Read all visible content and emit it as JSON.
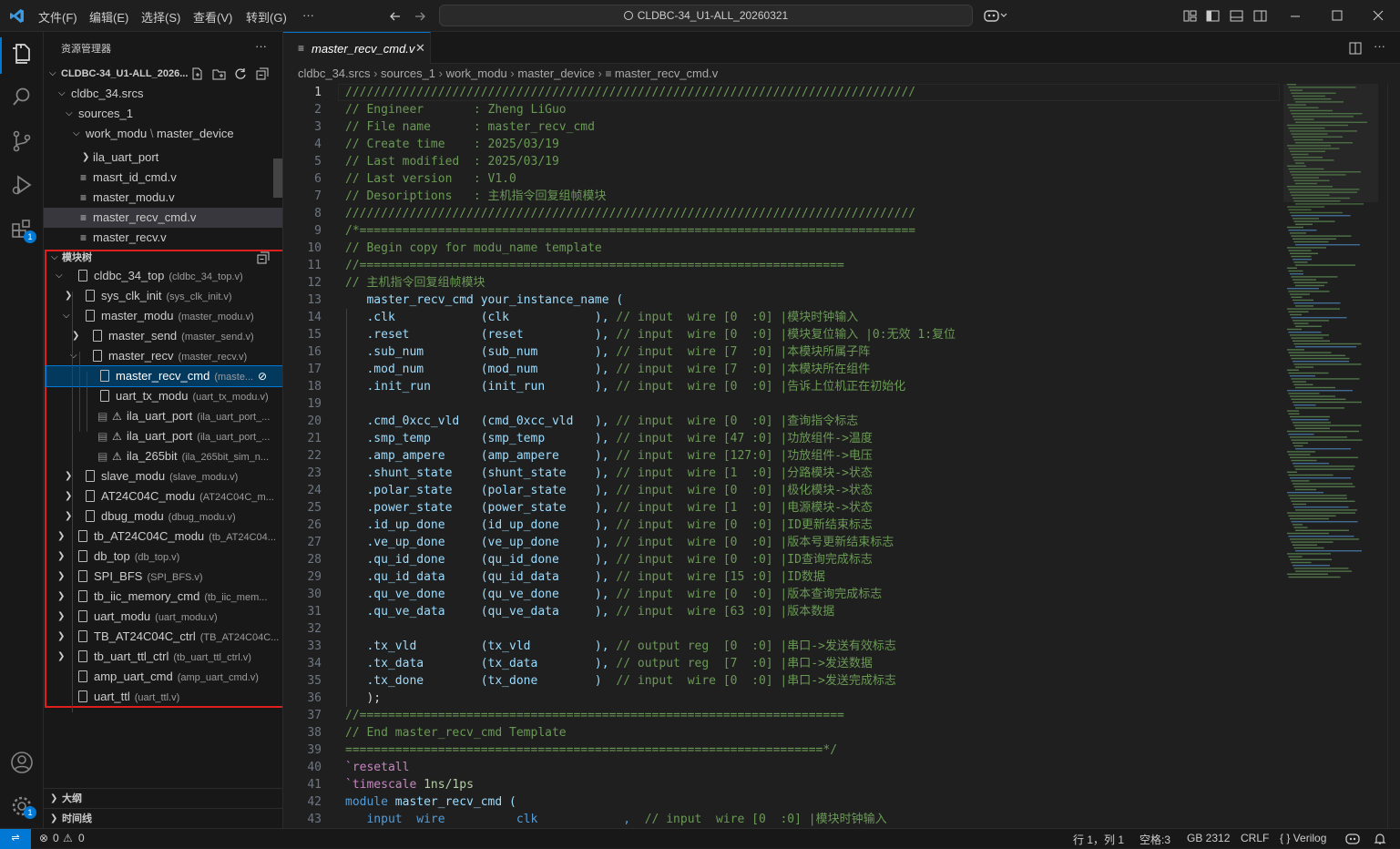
{
  "titlebar": {
    "menus": [
      "文件(F)",
      "编辑(E)",
      "选择(S)",
      "查看(V)",
      "转到(G)",
      "···"
    ],
    "search": "CLDBC-34_U1-ALL_20260321"
  },
  "explorer": {
    "title": "资源管理器",
    "root": "CLDBC-34_U1-ALL_2026...",
    "more": "···",
    "items": [
      {
        "label": "cldbc_34.srcs",
        "kind": "folder"
      },
      {
        "label": "sources_1",
        "kind": "folder"
      },
      {
        "label": "work_modu",
        "kind": "folder",
        "extra": "master_device"
      },
      {
        "label": "ila_uart_port",
        "kind": "folder-closed"
      },
      {
        "label": "masrt_id_cmd.v",
        "kind": "file"
      },
      {
        "label": "master_modu.v",
        "kind": "file"
      },
      {
        "label": "master_recv_cmd.v",
        "kind": "file",
        "selected": true
      },
      {
        "label": "master_recv.v",
        "kind": "file"
      }
    ]
  },
  "module_tree": {
    "title": "模块树",
    "items": [
      {
        "name": "cldbc_34_top",
        "file": "(cldbc_34_top.v)",
        "level": 0,
        "tw": "open"
      },
      {
        "name": "sys_clk_init",
        "file": "(sys_clk_init.v)",
        "level": 1,
        "tw": "closed"
      },
      {
        "name": "master_modu",
        "file": "(master_modu.v)",
        "level": 1,
        "tw": "open"
      },
      {
        "name": "master_send",
        "file": "(master_send.v)",
        "level": 2,
        "tw": "closed"
      },
      {
        "name": "master_recv",
        "file": "(master_recv.v)",
        "level": 2,
        "tw": "open"
      },
      {
        "name": "master_recv_cmd",
        "file": "(maste...",
        "level": 3,
        "tw": "none",
        "selected": true
      },
      {
        "name": "uart_tx_modu",
        "file": "(uart_tx_modu.v)",
        "level": 3,
        "tw": "none"
      },
      {
        "name": "ila_uart_port",
        "file": "(ila_uart_port_...",
        "level": 3,
        "tw": "none",
        "warn": true
      },
      {
        "name": "ila_uart_port",
        "file": "(ila_uart_port_...",
        "level": 3,
        "tw": "none",
        "warn": true
      },
      {
        "name": "ila_265bit",
        "file": "(ila_265bit_sim_n...",
        "level": 3,
        "tw": "none",
        "warn": true
      },
      {
        "name": "slave_modu",
        "file": "(slave_modu.v)",
        "level": 1,
        "tw": "closed"
      },
      {
        "name": "AT24C04C_modu",
        "file": "(AT24C04C_m...",
        "level": 1,
        "tw": "closed"
      },
      {
        "name": "dbug_modu",
        "file": "(dbug_modu.v)",
        "level": 1,
        "tw": "closed"
      },
      {
        "name": "tb_AT24C04C_modu",
        "file": "(tb_AT24C04...",
        "level": 0,
        "tw": "closed"
      },
      {
        "name": "db_top",
        "file": "(db_top.v)",
        "level": 0,
        "tw": "closed"
      },
      {
        "name": "SPI_BFS",
        "file": "(SPI_BFS.v)",
        "level": 0,
        "tw": "closed"
      },
      {
        "name": "tb_iic_memory_cmd",
        "file": "(tb_iic_mem...",
        "level": 0,
        "tw": "closed"
      },
      {
        "name": "uart_modu",
        "file": "(uart_modu.v)",
        "level": 0,
        "tw": "closed"
      },
      {
        "name": "TB_AT24C04C_ctrl",
        "file": "(TB_AT24C04C...",
        "level": 0,
        "tw": "closed"
      },
      {
        "name": "tb_uart_ttl_ctrl",
        "file": "(tb_uart_ttl_ctrl.v)",
        "level": 0,
        "tw": "closed"
      },
      {
        "name": "amp_uart_cmd",
        "file": "(amp_uart_cmd.v)",
        "level": 0,
        "tw": "none"
      },
      {
        "name": "uart_ttl",
        "file": "(uart_ttl.v)",
        "level": 0,
        "tw": "none"
      }
    ]
  },
  "outline": "大纲",
  "timeline": "时间线",
  "tab": {
    "label": "master_recv_cmd.v"
  },
  "breadcrumb": [
    "cldbc_34.srcs",
    "sources_1",
    "work_modu",
    "master_device",
    "master_recv_cmd.v"
  ],
  "code_lines": [
    "////////////////////////////////////////////////////////////////////////////////",
    "// Engineer       : Zheng LiGuo",
    "// File name      : master_recv_cmd",
    "// Create time    : 2025/03/19",
    "// Last modified  : 2025/03/19",
    "// Last version   : V1.0",
    "// Desoriptions   : 主机指令回复组帧模块",
    "////////////////////////////////////////////////////////////////////////////////",
    "/*==============================================================================",
    "// Begin copy for modu_name template",
    "//====================================================================",
    "// 主机指令回复组帧模块",
    "   master_recv_cmd your_instance_name (",
    "   .clk            (clk            ), // input  wire [0  :0] |模块时钟输入",
    "   .reset          (reset          ), // input  wire [0  :0] |模块复位输入 |0:无效 1:复位",
    "   .sub_num        (sub_num        ), // input  wire [7  :0] |本模块所属子阵",
    "   .mod_num        (mod_num        ), // input  wire [7  :0] |本模块所在组件",
    "   .init_run       (init_run       ), // input  wire [0  :0] |告诉上位机正在初始化",
    "",
    "   .cmd_0xcc_vld   (cmd_0xcc_vld   ), // input  wire [0  :0] |查询指令标志",
    "   .smp_temp       (smp_temp       ), // input  wire [47 :0] |功放组件->温度",
    "   .amp_ampere     (amp_ampere     ), // input  wire [127:0] |功放组件->电压",
    "   .shunt_state    (shunt_state    ), // input  wire [1  :0] |分路模块->状态",
    "   .polar_state    (polar_state    ), // input  wire [0  :0] |极化模块->状态",
    "   .power_state    (power_state    ), // input  wire [1  :0] |电源模块->状态",
    "   .id_up_done     (id_up_done     ), // input  wire [0  :0] |ID更新结束标志",
    "   .ve_up_done     (ve_up_done     ), // input  wire [0  :0] |版本号更新结束标志",
    "   .qu_id_done     (qu_id_done     ), // input  wire [0  :0] |ID查询完成标志",
    "   .qu_id_data     (qu_id_data     ), // input  wire [15 :0] |ID数据",
    "   .qu_ve_done     (qu_ve_done     ), // input  wire [0  :0] |版本查询完成标志",
    "   .qu_ve_data     (qu_ve_data     ), // input  wire [63 :0] |版本数据",
    "",
    "   .tx_vld         (tx_vld         ), // output reg  [0  :0] |串口->发送有效标志",
    "   .tx_data        (tx_data        ), // output reg  [7  :0] |串口->发送数据",
    "   .tx_done        (tx_done        )  // input  wire [0  :0] |串口->发送完成标志",
    "   );",
    "//====================================================================",
    "// End master_recv_cmd Template",
    "===================================================================*/",
    "`resetall",
    "`timescale 1ns/1ps",
    "module master_recv_cmd (",
    "   input  wire          clk            ,  // input  wire [0  :0] |模块时钟输入"
  ],
  "status": {
    "errors": "0",
    "warnings": "0",
    "position": "行 1，列 1",
    "spaces": "空格:3",
    "encoding": "GB 2312",
    "eol": "CRLF",
    "language": "{ } Verilog"
  },
  "badges": {
    "extensions": "1",
    "settings": "1"
  }
}
